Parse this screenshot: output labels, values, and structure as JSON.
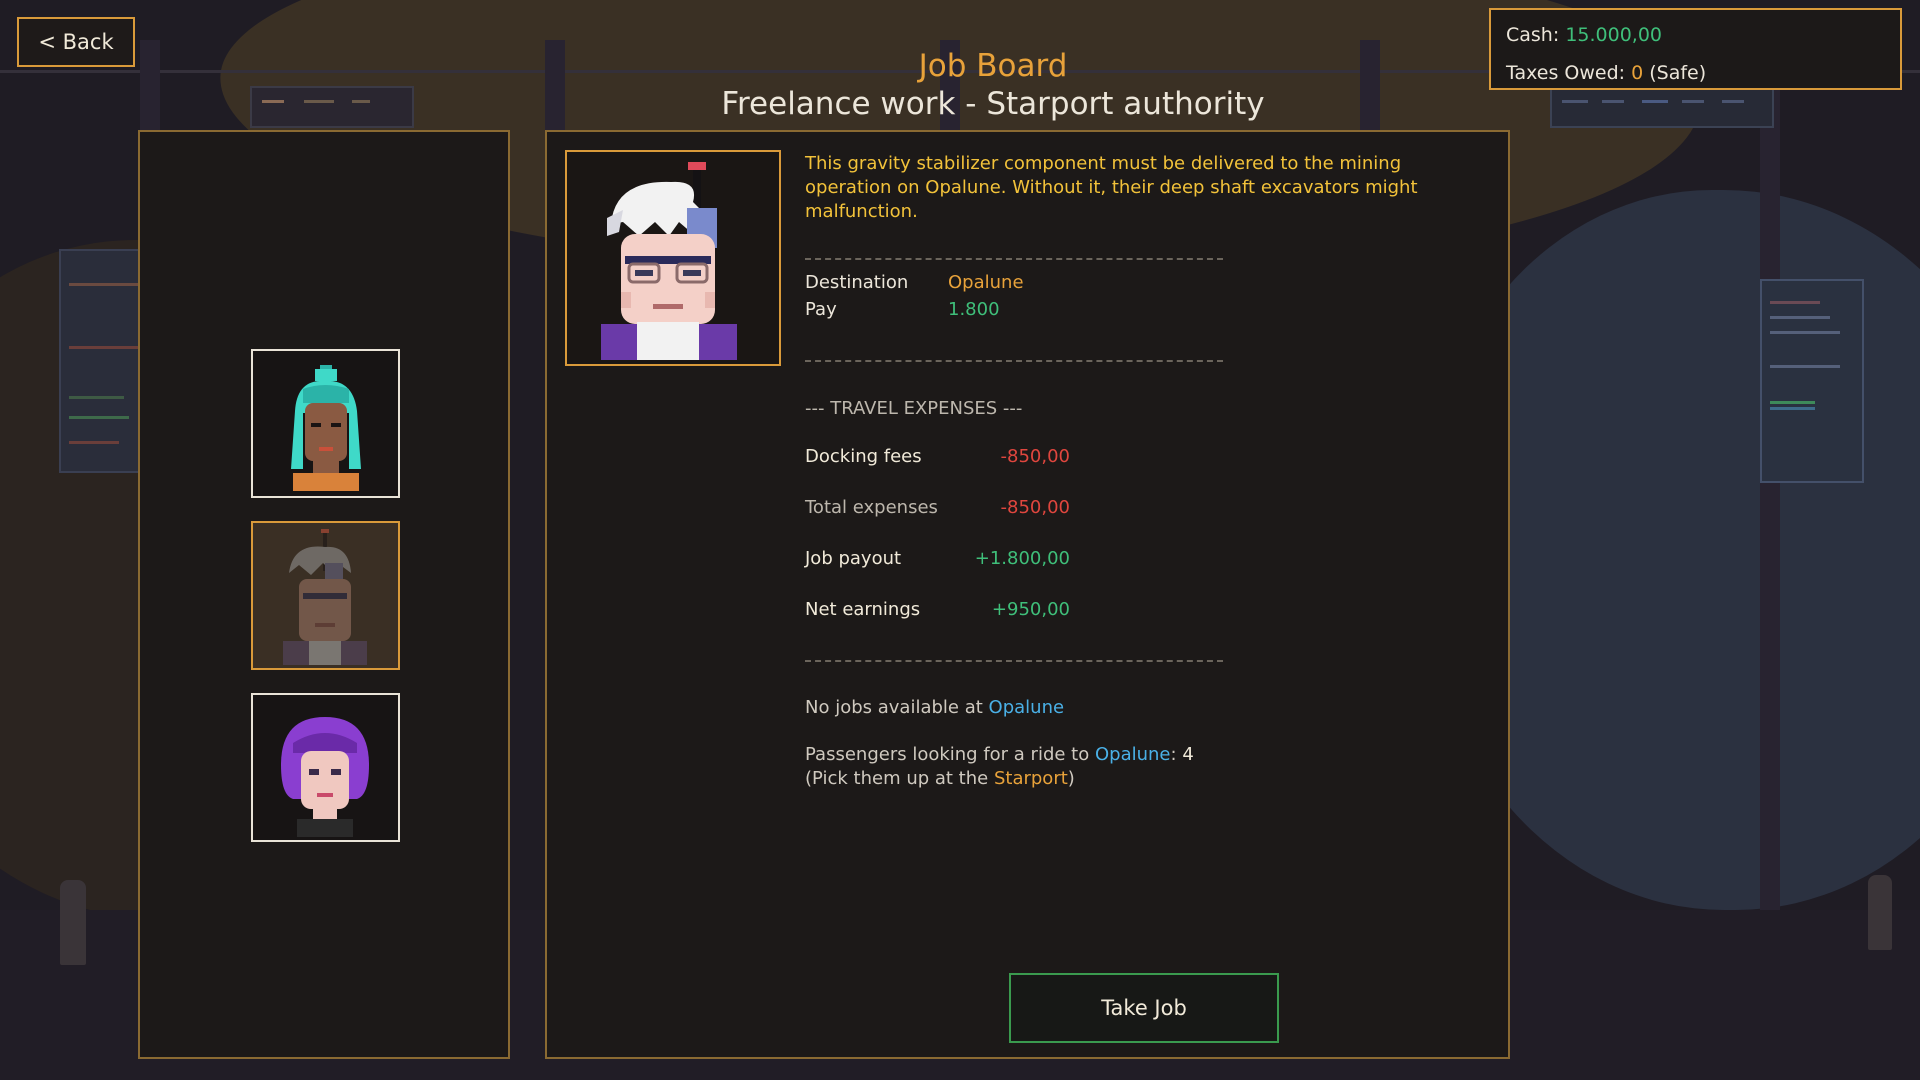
{
  "back_button": {
    "label": "< Back"
  },
  "money": {
    "cash_label": "Cash:",
    "cash_value": "15.000,00",
    "taxes_label": "Taxes Owed:",
    "taxes_value": "0",
    "taxes_status": "(Safe)"
  },
  "header": {
    "title": "Job Board",
    "subtitle": "Freelance work - Starport authority"
  },
  "job_list": {
    "items": [
      {
        "name": "client-teal-hair",
        "selected": false
      },
      {
        "name": "client-old-engineer",
        "selected": true
      },
      {
        "name": "client-purple-hair",
        "selected": false
      }
    ]
  },
  "job": {
    "description": "This gravity stabilizer component must be delivered to the mining operation on Opalune. Without it, their deep shaft excavators might malfunction.",
    "destination_label": "Destination",
    "destination_value": "Opalune",
    "pay_label": "Pay",
    "pay_value": "1.800"
  },
  "expenses": {
    "title": "--- TRAVEL EXPENSES ---",
    "docking_label": "Docking fees",
    "docking_value": "-850,00",
    "total_label": "Total expenses",
    "total_value": "-850,00",
    "payout_label": "Job payout",
    "payout_value": "+1.800,00",
    "net_label": "Net earnings",
    "net_value": "+950,00"
  },
  "info": {
    "no_jobs_prefix": "No jobs available at",
    "no_jobs_planet": "Opalune",
    "passengers_prefix": "Passengers looking for a ride to",
    "passengers_planet": "Opalune",
    "passengers_colon": ":",
    "passengers_count": "4",
    "pickup_prefix": "(Pick them up at the",
    "pickup_place": "Starport",
    "pickup_suffix": ")"
  },
  "take_button": {
    "label": "Take Job"
  },
  "colors": {
    "accent": "#d99a3a",
    "positive": "#3fbf7a",
    "negative": "#e0463e",
    "highlight_blue": "#4ab0e6",
    "description": "#f2c23a"
  }
}
